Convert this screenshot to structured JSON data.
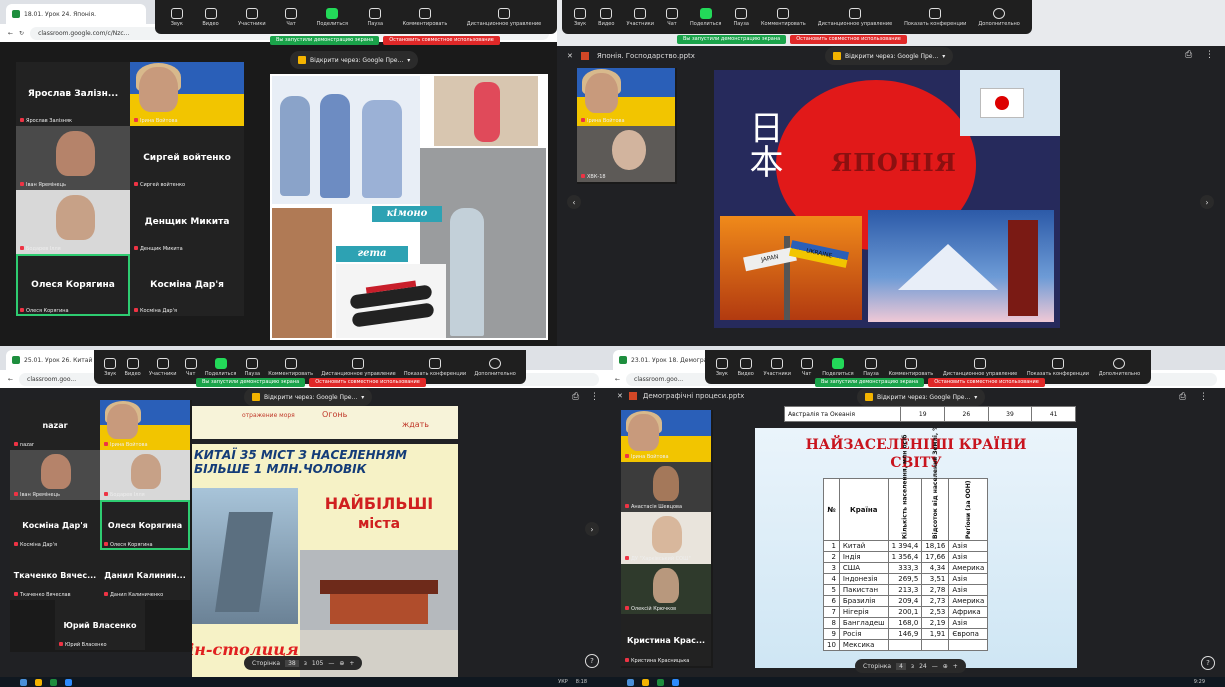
{
  "zoom_toolbar": {
    "buttons": [
      "Звук",
      "Видео",
      "Участники",
      "Чат",
      "Поделиться",
      "Пауза",
      "Комментировать",
      "Дистанционное управление",
      "Показать конференции",
      "Дополнительно"
    ],
    "participants_count_q1": "9",
    "participants_count_q2": "2",
    "participants_count_q3": "9",
    "participants_count_q4": "5"
  },
  "banner": {
    "sharing": "Вы запустили демонстрацию экрана",
    "stop": "Остановить совместное использование"
  },
  "q1": {
    "tab_title": "18.01. Урок 24. Японія.",
    "url": "classroom.google.com/c/Nzc...",
    "open_with": "Відкрити через: Google Пре...",
    "tiles": [
      {
        "name": "Ярослав Залізн...",
        "label": "Ярослав Залізняк"
      },
      {
        "name": "",
        "label": "Ірина Войтова"
      },
      {
        "name": "",
        "label": "Іван Яремінець"
      },
      {
        "name": "Сиргей войтенко",
        "label": "Сиргей войтенко"
      },
      {
        "name": "",
        "label": "Бодарев Ілля"
      },
      {
        "name": "Денщик Микита",
        "label": "Денщик Микита"
      },
      {
        "name": "Олеся Корягина",
        "label": "Олеся Корягина"
      },
      {
        "name": "Косміна Дар'я",
        "label": "Косміна Дар'я"
      }
    ],
    "slide_labels": {
      "kimono": "кімоно",
      "geta": "гета"
    }
  },
  "q2": {
    "doc_title": "Японія. Господарство.pptx",
    "open_with": "Відкрити через: Google Пре...",
    "tiles": [
      {
        "label": "Ірина Войтова"
      },
      {
        "label": "ХВК-18"
      }
    ],
    "slide_title": "ЯПОНІЯ",
    "kanji": "日本",
    "sign_text": "UKRAINE",
    "sign_text2": "JAPAN"
  },
  "q3": {
    "tab_title": "25.01. Урок 26. Китай",
    "url": "classroom.goo...",
    "open_with": "Відкрити через: Google Пре...",
    "tiles": [
      {
        "name": "nazar",
        "label": "nazar"
      },
      {
        "name": "",
        "label": "Ірина Войтова"
      },
      {
        "name": "",
        "label": "Іван Яремінець"
      },
      {
        "name": "",
        "label": "Бодарев Ілля"
      },
      {
        "name": "Косміна Дар'я",
        "label": "Косміна Дар'я"
      },
      {
        "name": "Олеся Корягина",
        "label": "Олеся Корягина"
      },
      {
        "name": "Ткаченко Вячес...",
        "label": "Ткаченко Вячеслав"
      },
      {
        "name": "Данил Калинин...",
        "label": "Данил Калиниченко"
      },
      {
        "name": "Юрий Власенко",
        "label": "Юрий Власенко"
      }
    ],
    "slide_heading": "КИТАЇ 35 МІСТ З НАСЕЛЕННЯМ БІЛЬШЕ 1 МЛН.ЧОЛОВІК",
    "slide_big": "НАЙБІЛЬШІ",
    "slide_big2": "міста",
    "slide_bottom": "Пекін-столиця",
    "slide_top_left": "Огонь",
    "slide_top_left2": "отражение моря",
    "slide_top_right": "ждать",
    "pager": {
      "label": "Сторінка",
      "current": "38",
      "sep": "з",
      "total": "105"
    }
  },
  "q4": {
    "tab_title": "23.01. Урок 18. Демографічні...",
    "url": "classroom.goo...",
    "doc_title": "Демографічні процеси.pptx",
    "open_with": "Відкрити через: Google Пре...",
    "tiles": [
      {
        "label": "Ірина Войтова"
      },
      {
        "label": "Анастасія Шевцова"
      },
      {
        "label": "ДУ \"Харківський СОШ\""
      },
      {
        "label": "Олексій Крючков"
      },
      {
        "name": "Кристина Крас...",
        "label": "Кристина Красницька"
      }
    ],
    "top_row": {
      "region": "Австралія та Океанія",
      "v1": "19",
      "v2": "26",
      "v3": "39",
      "v4": "41"
    },
    "slide_title": "НАЙЗАСЕЛЕНІШІ КРАЇНИ СВІТУ",
    "table": {
      "headers": [
        "№",
        "Країна",
        "Кількість населення, млн осіб",
        "Відсоток від населення Землі, %",
        "Регіони (за ООН)"
      ],
      "rows": [
        [
          "1",
          "Китай",
          "1 394,4",
          "18,16",
          "Азія"
        ],
        [
          "2",
          "Індія",
          "1 356,4",
          "17,66",
          "Азія"
        ],
        [
          "3",
          "США",
          "333,3",
          "4,34",
          "Америка"
        ],
        [
          "4",
          "Індонезія",
          "269,5",
          "3,51",
          "Азія"
        ],
        [
          "5",
          "Пакистан",
          "213,3",
          "2,78",
          "Азія"
        ],
        [
          "6",
          "Бразилія",
          "209,4",
          "2,73",
          "Америка"
        ],
        [
          "7",
          "Нігерія",
          "200,1",
          "2,53",
          "Африка"
        ],
        [
          "8",
          "Бангладеш",
          "168,0",
          "2,19",
          "Азія"
        ],
        [
          "9",
          "Росія",
          "146,9",
          "1,91",
          "Європа"
        ],
        [
          "10",
          "Мексика",
          "",
          "",
          ""
        ]
      ]
    },
    "pager": {
      "label": "Сторінка",
      "current": "4",
      "sep": "з",
      "total": "24"
    }
  },
  "taskbar": {
    "lang": "УКР",
    "time_q3": "8:18",
    "time_q4": "9:29"
  }
}
